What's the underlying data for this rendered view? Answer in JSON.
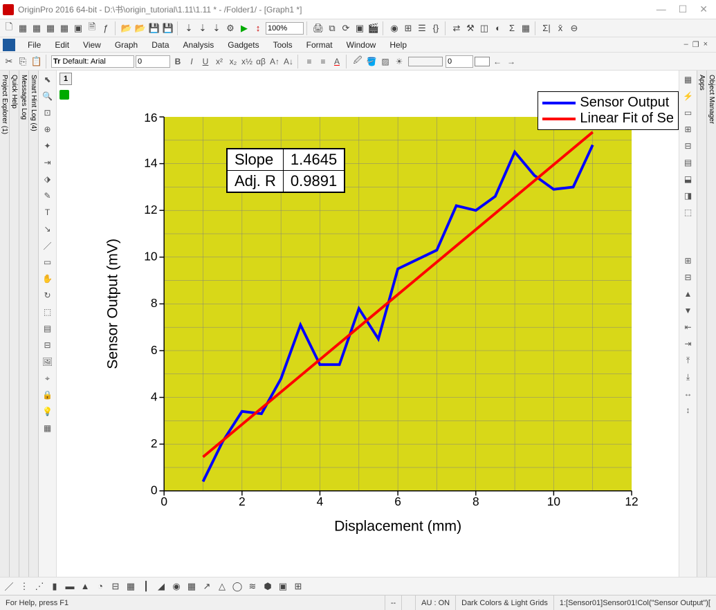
{
  "window": {
    "title": "OriginPro 2016 64-bit - D:\\书\\origin_tutorial\\1.11\\1.11 * - /Folder1/ - [Graph1 *]"
  },
  "toolbar": {
    "zoom_value": "100%"
  },
  "menu": {
    "items": [
      "File",
      "Edit",
      "View",
      "Graph",
      "Data",
      "Analysis",
      "Gadgets",
      "Tools",
      "Format",
      "Window",
      "Help"
    ]
  },
  "format_bar": {
    "font_label_prefix": "Tr ",
    "font_name": "Default: Arial",
    "font_size": "0",
    "num_value": "0"
  },
  "side_tabs": {
    "left1": "Project Explorer (1)",
    "left2": "Quick Help",
    "left3": "Messages Log",
    "left4": "Smart Hint Log (4)",
    "right1": "Apps",
    "right2": "Object Manager"
  },
  "workspace": {
    "layer_tab": "1"
  },
  "legend": {
    "series1": "Sensor Output",
    "series2": "Linear Fit of Se"
  },
  "stats": {
    "row1_label": "Slope",
    "row1_value": "1.4645",
    "row2_label": "Adj. R",
    "row2_value": "0.9891"
  },
  "chart_data": {
    "type": "line",
    "xlabel": "Displacement (mm)",
    "ylabel": "Sensor Output (mV)",
    "xlim": [
      0,
      12
    ],
    "ylim": [
      0,
      16
    ],
    "xticks": [
      0,
      2,
      4,
      6,
      8,
      10,
      12
    ],
    "yticks": [
      0,
      2,
      4,
      6,
      8,
      10,
      12,
      14,
      16
    ],
    "series": [
      {
        "name": "Sensor Output",
        "color": "#0000ff",
        "x": [
          1.0,
          1.5,
          2.0,
          2.5,
          3.0,
          3.5,
          4.0,
          4.5,
          5.0,
          5.5,
          6.0,
          6.5,
          7.0,
          7.5,
          8.0,
          8.5,
          9.0,
          9.5,
          10.0,
          10.5,
          11.0
        ],
        "y": [
          0.4,
          2.1,
          3.4,
          3.3,
          4.8,
          7.1,
          5.4,
          5.4,
          7.8,
          6.5,
          9.5,
          9.9,
          10.3,
          12.2,
          12.0,
          12.6,
          14.5,
          13.5,
          12.9,
          13.0,
          14.8
        ]
      },
      {
        "name": "Linear Fit",
        "color": "#ff0000",
        "x": [
          1.0,
          11.0
        ],
        "y": [
          1.45,
          15.35
        ]
      }
    ]
  },
  "status": {
    "help": "For Help, press F1",
    "dash": "--",
    "au": "AU : ON",
    "theme": "Dark Colors & Light Grids",
    "dataset": "1:[Sensor01]Sensor01!Col(\"Sensor Output\")["
  }
}
